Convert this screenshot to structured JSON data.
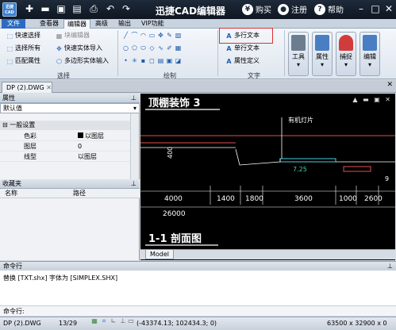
{
  "app": {
    "logo_text": "迅捷CAD",
    "title": "迅捷CAD编辑器"
  },
  "quick_access": [
    "new-icon",
    "open-icon",
    "save-icon",
    "saveas-icon",
    "print-icon",
    "undo-icon",
    "redo-icon"
  ],
  "top_right": {
    "buy": "购买",
    "register": "注册",
    "help": "帮助"
  },
  "menu": {
    "file": "文件",
    "viewer": "查看器",
    "editor": "编辑器",
    "advanced": "高级",
    "output": "输出",
    "vip": "VIP功能"
  },
  "ribbon": {
    "select": {
      "quick_select": "快速选择",
      "select_all": "选择所有",
      "match_props": "匹配属性",
      "block_editor": "块编辑器",
      "quick_import": "快速实体导入",
      "polygon_import": "多边形实体输入",
      "group_label": "选择"
    },
    "draw": {
      "group_label": "绘制"
    },
    "text": {
      "mtext": "多行文本",
      "stext": "单行文本",
      "attdef": "属性定义",
      "group_label": "文字"
    },
    "tools": "工具",
    "properties": "属性",
    "snap": "捕捉",
    "edit": "编辑"
  },
  "tab": {
    "doc_name": "DP (2).DWG"
  },
  "props_panel": {
    "title": "属性",
    "dropdown": "默认值",
    "section": "一般设置",
    "rows": [
      {
        "k": "色彩",
        "v": "以图层"
      },
      {
        "k": "图层",
        "v": "0"
      },
      {
        "k": "线型",
        "v": "以图层"
      }
    ]
  },
  "fav_panel": {
    "title": "收藏夹",
    "col_name": "名称",
    "col_path": "路径"
  },
  "drawing": {
    "title1": "顶棚装饰 3",
    "lamp": "有机灯片",
    "elev1": "400",
    "elev2": "7.25",
    "elev3": "9",
    "dims": [
      "4000",
      "1400",
      "1800",
      "3600",
      "1000",
      "2600"
    ],
    "total": "26000",
    "section": "1-1 剖面图"
  },
  "model_tab": "Model",
  "command": {
    "header": "命令行",
    "output": "替换 [TXT.shx] 字体为 [SIMPLEX.SHX]",
    "prompt": "命令行:"
  },
  "status": {
    "doc": "DP (2).DWG",
    "pages": "13/29",
    "coords": "(-43374.13; 102434.3; 0)",
    "size": "63500 x 32900 x 0"
  }
}
